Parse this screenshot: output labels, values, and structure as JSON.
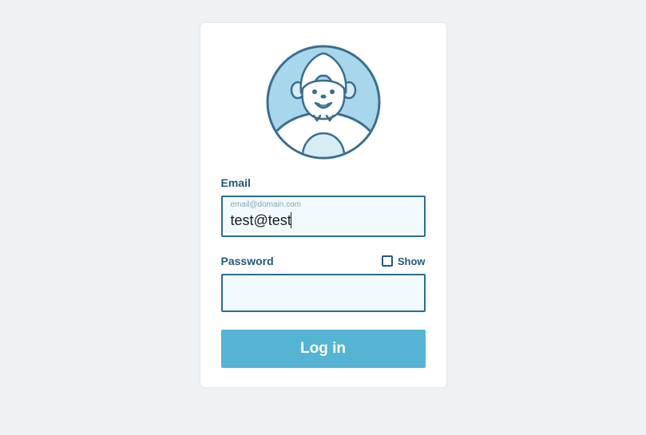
{
  "avatar": {
    "name": "yeti-avatar"
  },
  "email": {
    "label": "Email",
    "placeholder": "email@domain.com",
    "value": "test@test"
  },
  "password": {
    "label": "Password",
    "show_label": "Show",
    "value": ""
  },
  "login_button": "Log in",
  "colors": {
    "card_bg": "#ffffff",
    "page_bg": "#eef2f4",
    "primary_dark": "#25597a",
    "input_border": "#2b6f90",
    "input_bg": "#f2fafd",
    "button_bg": "#55b4d4"
  }
}
